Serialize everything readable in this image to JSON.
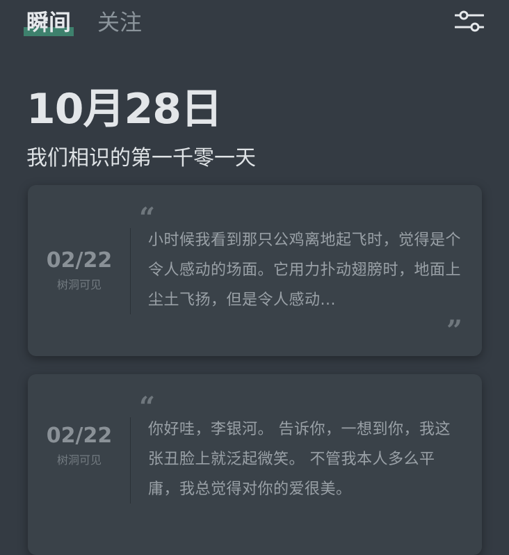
{
  "tabs": [
    {
      "label": "瞬间",
      "active": true
    },
    {
      "label": "关注",
      "active": false
    }
  ],
  "header": {
    "filter_icon": "sliders-icon"
  },
  "date": "10月28日",
  "subtitle": "我们相识的第一千零一天",
  "cards": [
    {
      "date": "02/22",
      "visibility": "树洞可见",
      "text": "小时候我看到那只公鸡离地起飞时，觉得是个令人感动的场面。它用力扑动翅膀时，地面上尘土飞扬，但是令人感动..."
    },
    {
      "date": "02/22",
      "visibility": "树洞可见",
      "text": "你好哇，李银河。  告诉你，一想到你，我这张丑脸上就泛起微笑。  不管我本人多么平庸，我总觉得对你的爱很美。"
    }
  ],
  "colors": {
    "background": "#343b43",
    "card": "#3a4249",
    "accent": "#3f8a72"
  }
}
